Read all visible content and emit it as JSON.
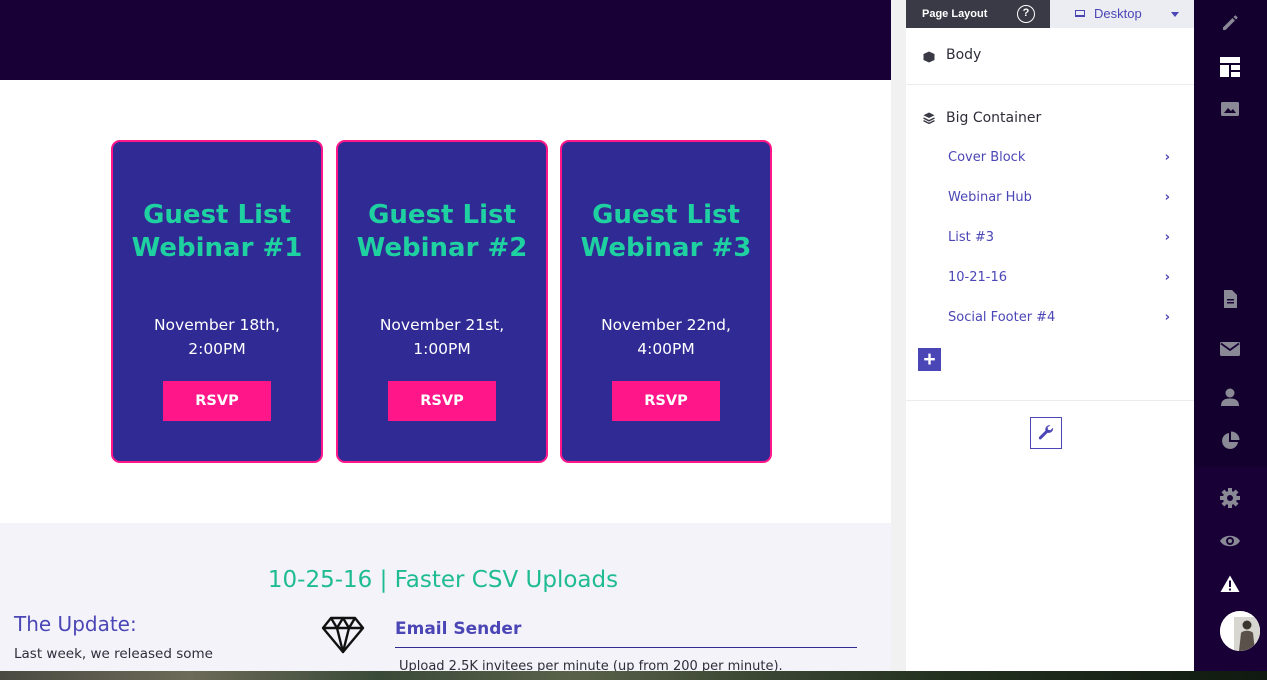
{
  "canvas": {
    "webinars": [
      {
        "title": "Guest List Webinar #1",
        "date": "November 18th, 2:00PM",
        "button": "RSVP"
      },
      {
        "title": "Guest List Webinar #2",
        "date": "November 21st, 1:00PM",
        "button": "RSVP"
      },
      {
        "title": "Guest List Webinar #3",
        "date": "November 22nd, 4:00PM",
        "button": "RSVP"
      }
    ],
    "release": {
      "heading": "10-25-16 | Faster CSV Uploads",
      "update_title": "The Update:",
      "update_text": "Last week, we released some",
      "feature_title": "Email Sender",
      "feature_text": "Upload 2.5K invitees per minute (up from 200 per minute)."
    }
  },
  "panel": {
    "tab_label": "Page Layout",
    "help": "?",
    "device": "Desktop",
    "body_label": "Body",
    "container_label": "Big Container",
    "blocks": [
      "Cover Block",
      "Webinar Hub",
      "List #3",
      "10-21-16",
      "Social Footer #4"
    ],
    "add": "+"
  },
  "toolbar": {
    "tools": [
      "pencil-icon",
      "layout-icon",
      "image-icon",
      "document-icon",
      "mail-icon",
      "person-icon",
      "pie-chart-icon",
      "settings-icon",
      "eye-icon",
      "warning-icon"
    ]
  },
  "colors": {
    "brand_dark": "#180037",
    "card_bg": "#302a94",
    "accent_pink": "#ff1789",
    "accent_green": "#1fd1a0",
    "panel_link": "#4b46b6"
  }
}
